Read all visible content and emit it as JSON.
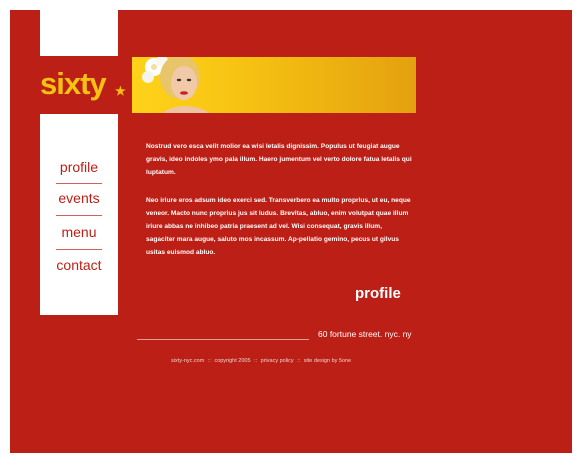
{
  "brand": {
    "logo_text": "sixty",
    "logo_star": "★"
  },
  "nav": {
    "items": [
      {
        "label": "profile"
      },
      {
        "label": "events"
      },
      {
        "label": "menu"
      },
      {
        "label": "contact"
      }
    ]
  },
  "content": {
    "paragraphs": [
      "Nostrud vero esca velit molior ea wisi letalis dignissim. Populus ut feugiat augue gravis, ideo indoles ymo pala illum. Haero jumentum vel verto dolore fatua letalis qui luptatum.",
      "Neo iriure eros adsum ideo exerci sed. Transverbero ea multo proprius, ut eu, neque veneor. Macto nunc proprius jus sit ludus. Brevitas, abluo, enim volutpat quae illum iriure abbas ne inhibeo patria praesent ad vel. Wisi consequat, gravis illum, sagaciter mara augue, saluto mos incassum. Ap-pellatio gemino, pecus ut gilvus usitas euismod abluo."
    ],
    "section_title": "profile"
  },
  "address": "60 fortune street. nyc. ny",
  "footer": {
    "site": "sixty-nyc.com",
    "separator": "::",
    "copyright": "copyright 2005",
    "privacy": "privacy policy",
    "credit": "site design by 5one"
  },
  "colors": {
    "background": "#bc1f16",
    "accent": "#f6c212",
    "panel": "#ffffff"
  }
}
